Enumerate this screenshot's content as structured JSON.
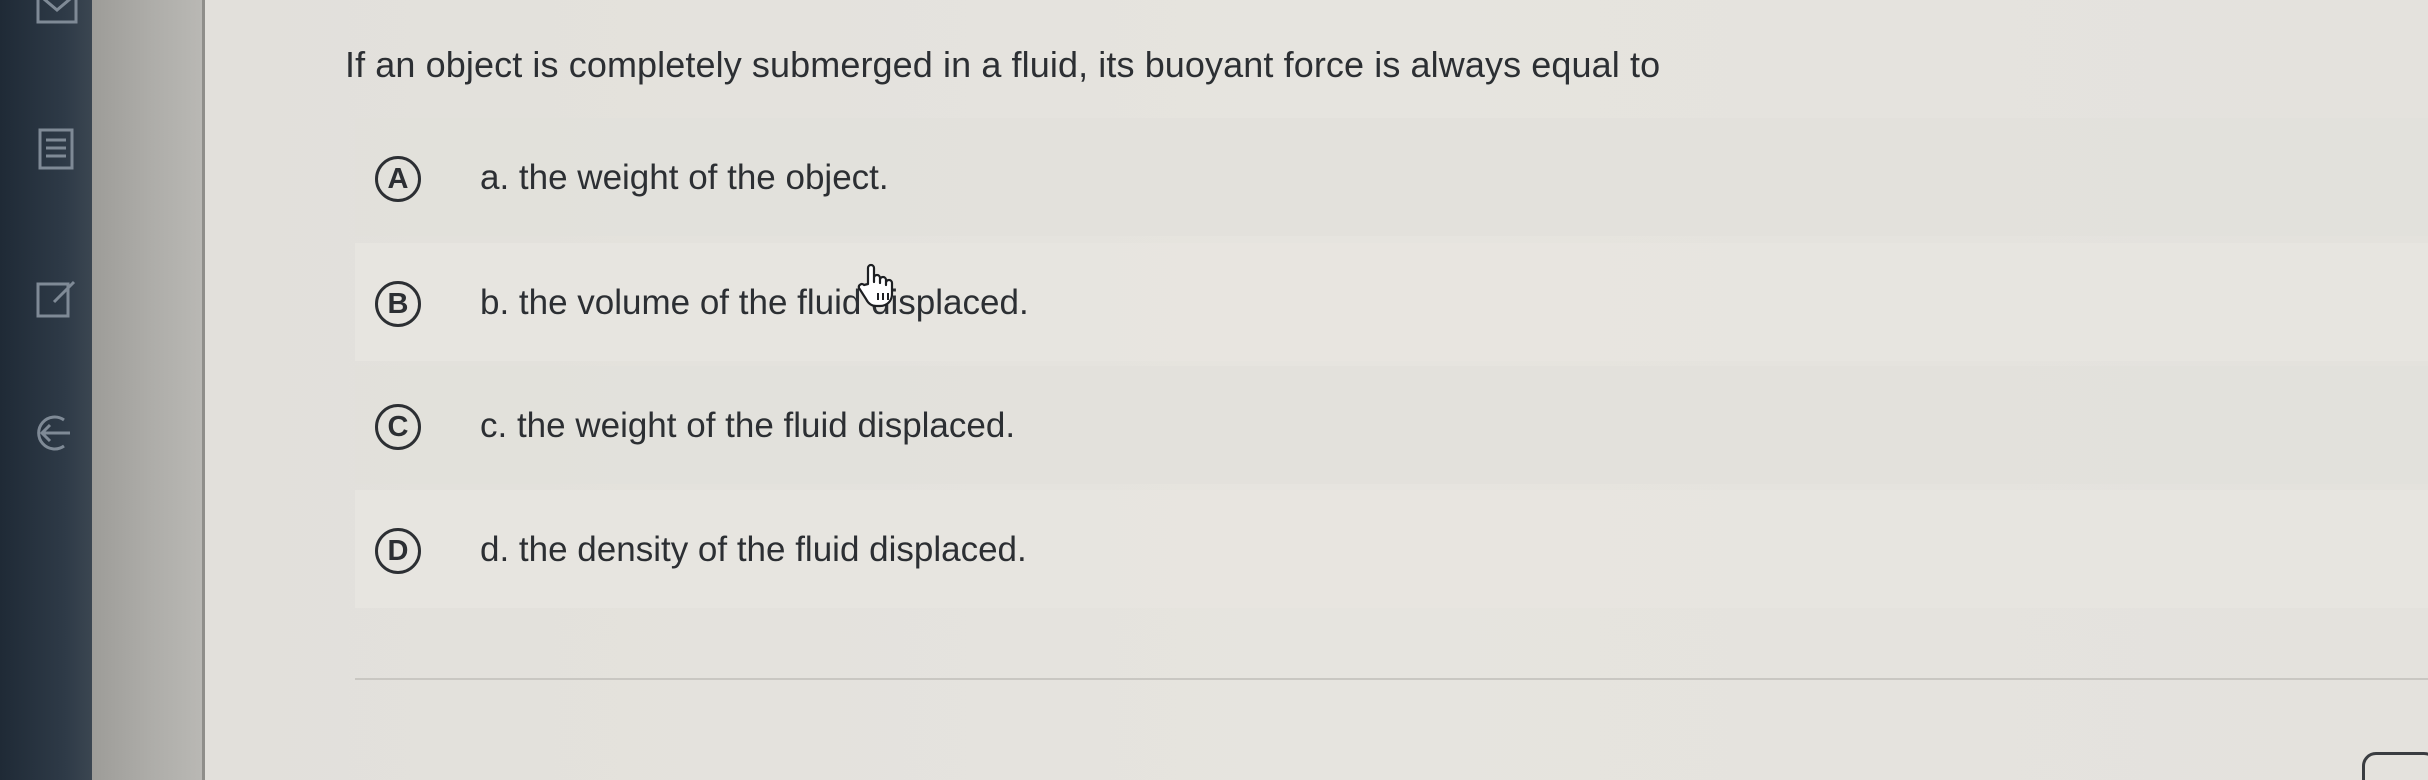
{
  "question": {
    "text": "If an object is completely submerged in a fluid, its buoyant force is always equal to"
  },
  "options": [
    {
      "badge": "A",
      "text": "a. the weight of the object."
    },
    {
      "badge": "B",
      "text": "b. the volume of the fluid displaced."
    },
    {
      "badge": "C",
      "text": "c. the weight of the fluid displaced."
    },
    {
      "badge": "D",
      "text": "d. the density of the fluid displaced."
    }
  ],
  "sidebar": {
    "icons": [
      "mail-icon",
      "document-list-icon",
      "edit-icon",
      "exit-icon"
    ]
  },
  "colors": {
    "text": "#2c2f33",
    "rail": "#2e3a47",
    "background": "#e4e2dd"
  }
}
